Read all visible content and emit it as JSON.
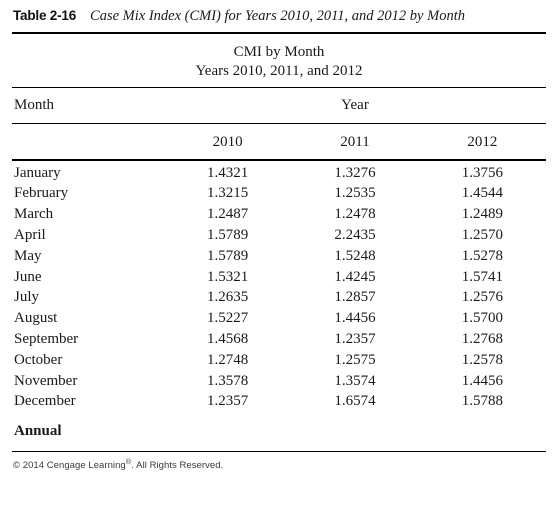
{
  "caption": {
    "label": "Table 2-16",
    "text": "Case Mix Index (CMI) for Years 2010, 2011, and 2012 by Month"
  },
  "title": {
    "line1": "CMI by Month",
    "line2": "Years 2010, 2011, and 2012"
  },
  "headers": {
    "month": "Month",
    "year_group": "Year",
    "years": [
      "2010",
      "2011",
      "2012"
    ]
  },
  "rows": [
    {
      "month": "January",
      "values": [
        "1.4321",
        "1.3276",
        "1.3756"
      ]
    },
    {
      "month": "February",
      "values": [
        "1.3215",
        "1.2535",
        "1.4544"
      ]
    },
    {
      "month": "March",
      "values": [
        "1.2487",
        "1.2478",
        "1.2489"
      ]
    },
    {
      "month": "April",
      "values": [
        "1.5789",
        "2.2435",
        "1.2570"
      ]
    },
    {
      "month": "May",
      "values": [
        "1.5789",
        "1.5248",
        "1.5278"
      ]
    },
    {
      "month": "June",
      "values": [
        "1.5321",
        "1.4245",
        "1.5741"
      ]
    },
    {
      "month": "July",
      "values": [
        "1.2635",
        "1.2857",
        "1.2576"
      ]
    },
    {
      "month": "August",
      "values": [
        "1.5227",
        "1.4456",
        "1.5700"
      ]
    },
    {
      "month": "September",
      "values": [
        "1.4568",
        "1.2357",
        "1.2768"
      ]
    },
    {
      "month": "October",
      "values": [
        "1.2748",
        "1.2575",
        "1.2578"
      ]
    },
    {
      "month": "November",
      "values": [
        "1.3578",
        "1.3574",
        "1.4456"
      ]
    },
    {
      "month": "December",
      "values": [
        "1.2357",
        "1.6574",
        "1.5788"
      ]
    }
  ],
  "annual": {
    "label": "Annual",
    "values": [
      "",
      "",
      ""
    ]
  },
  "footer": {
    "prefix": "© 2014 Cengage Learning",
    "mark": "®",
    "suffix": ". All Rights Reserved."
  },
  "colors": {
    "rule": "#000000",
    "text": "#1a1a1a",
    "footer_text": "#3a3a3a",
    "background": "#ffffff"
  }
}
